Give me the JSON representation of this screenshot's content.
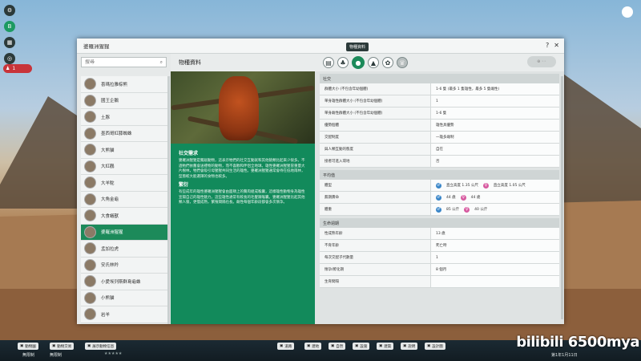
{
  "window": {
    "title": "婆羅洲猩猩",
    "help": "?",
    "close": "✕"
  },
  "search": {
    "placeholder": "搜尋"
  },
  "species_list": [
    {
      "label": "喜瑪拉雅棕熊"
    },
    {
      "label": "國王企鵝"
    },
    {
      "label": "土豚"
    },
    {
      "label": "墨西哥紅膝蜘蛛"
    },
    {
      "label": "大熊貓"
    },
    {
      "label": "大紅鸛"
    },
    {
      "label": "大羊駝"
    },
    {
      "label": "大角金龜"
    },
    {
      "label": "大食蟻獸"
    },
    {
      "label": "婆羅洲猩猩"
    },
    {
      "label": "孟加拉虎"
    },
    {
      "label": "安氏林羚"
    },
    {
      "label": "小愛埃列斯群島龜蛛"
    },
    {
      "label": "小熊貓"
    },
    {
      "label": "岩羊"
    }
  ],
  "selected_species": "婆羅洲猩猩",
  "center": {
    "header": "物種資料",
    "social_title": "社交需求",
    "social_text": "婆羅洲猩猩是獨居動物，這表示牠們的社交互動就和其他猿類比起來少很多。不過牠們依舊會送禮物的動物，而不喜歡和伴侶全地球。雄性婆羅洲猩猩冒重量大片樹林，牠們會吸引母猩猩共同生活的雄性。婆羅洲猩猩通常會待在低地雨林，型態較大能選擇的食物也較多。",
    "breeding_title": "繁衍",
    "breeding_text": "有些成年的雄性婆羅洲猩猩會由面頰上的贅肉組成喉囊，這樣雄性動物身為雄性宣揚自己的雄性魅力。這些雄性通常有較長的毛髮跟喉囊。婆羅洲猩猩比起其他類人猿，更慢成熟，繁殖間隔也長。雌性每個年齡段都會多次懷孕。"
  },
  "tabs": {
    "tooltip": "物種資料",
    "items": [
      {
        "icon": "book-icon"
      },
      {
        "icon": "tree-icon"
      },
      {
        "icon": "droplet-icon"
      },
      {
        "icon": "habitat-icon"
      },
      {
        "icon": "paw-icon"
      },
      {
        "icon": "trophy-icon"
      }
    ],
    "right_button": "⊕ ◦◦"
  },
  "sections": [
    {
      "title": "社交",
      "rows": [
        {
          "k": "群體大小 (不包含年幼個體)",
          "v": "1-6 隻 (最多 1 隻雄性，最多 5 隻雌性)"
        },
        {
          "k": "單身雄性群體大小 (不包含年幼個體)",
          "v": "1"
        },
        {
          "k": "單身雌性群體大小 (不包含年幼個體)",
          "v": "1-6 隻"
        },
        {
          "k": "優勢個體",
          "v": "雄性具優勢"
        },
        {
          "k": "交配制度",
          "v": "一雄多雌制"
        },
        {
          "k": "與人類互動的態度",
          "v": "自在"
        },
        {
          "k": "接者可進入環地",
          "v": "否"
        }
      ]
    },
    {
      "title": "平均值",
      "rows": [
        {
          "k": "體型",
          "male": "直立高度 1.35 公尺",
          "female": "直立高度 1.05 公尺"
        },
        {
          "k": "無期壽命",
          "male": "44 歲",
          "female": "44 歲"
        },
        {
          "k": "體重",
          "male": "85 公斤",
          "female": "40 公斤"
        }
      ]
    },
    {
      "title": "生命週期",
      "rows": [
        {
          "k": "性成熟年齡",
          "v": "13 歲"
        },
        {
          "k": "不育年齡",
          "v": "死亡時"
        },
        {
          "k": "每次交配子代數量",
          "v": "1"
        },
        {
          "k": "懷孕/孵化期",
          "v": "8 個月"
        },
        {
          "k": "生育間隔",
          "v": ""
        }
      ]
    }
  ],
  "bottom": {
    "btn_animals": "動物園",
    "btn_animals2": "動物交易",
    "btn_info": "展示動物信息",
    "speed_label": "無限制",
    "speed_label2": "無限制",
    "tools": [
      "道路",
      "建地",
      "自然",
      "設施",
      "建築",
      "說明",
      "設計圖"
    ],
    "date": "第1年1月11日"
  },
  "watermark": "bilibili 6500mya",
  "hud_badge": "1"
}
